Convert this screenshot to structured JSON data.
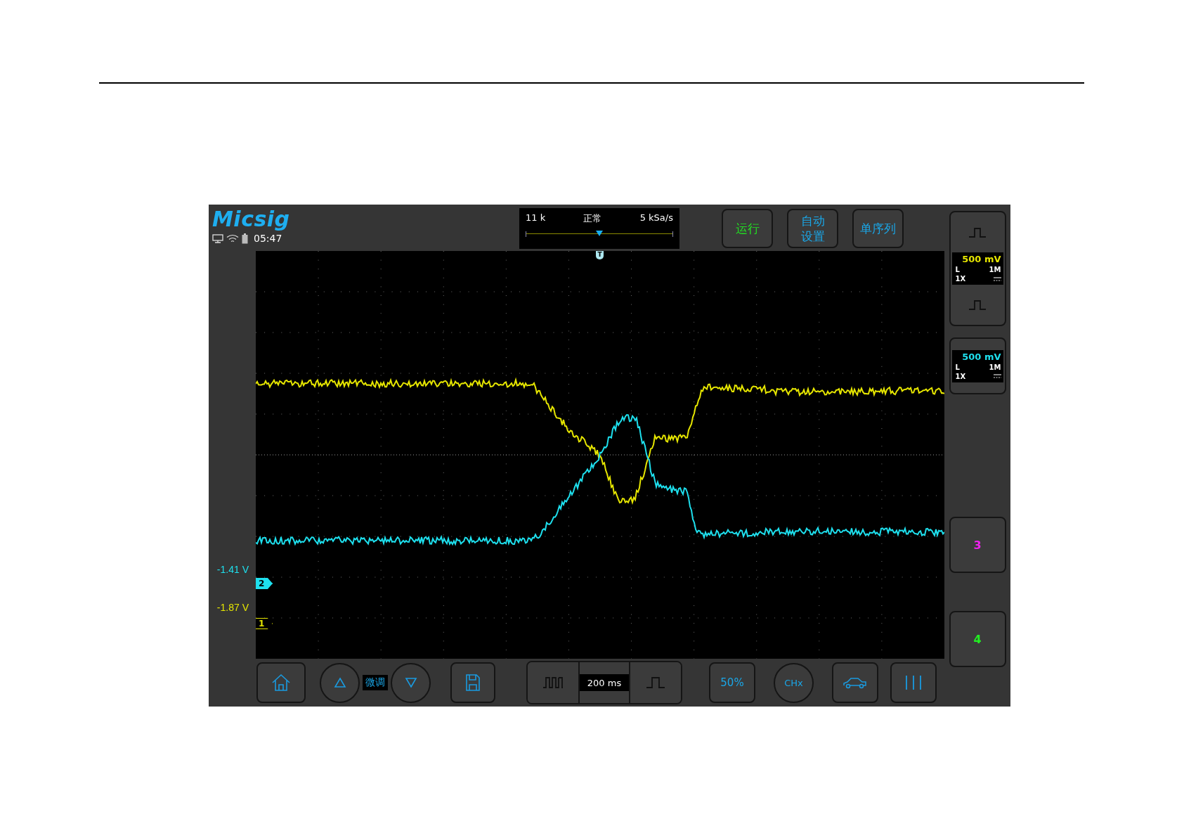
{
  "header": {
    "logo": "Micsig",
    "time": "05:47"
  },
  "acquisition": {
    "memory": "11 k",
    "mode": "正常",
    "sample_rate": "5 kSa/s",
    "level": 0.5
  },
  "top_buttons": [
    {
      "label": "运行",
      "color": "#22dd22"
    },
    {
      "label": "自动设置",
      "color": "#1aa7e8"
    },
    {
      "label": "单序列",
      "color": "#1aa7e8"
    }
  ],
  "trigger_marker": "T",
  "offset_markers": [
    {
      "marker": "2",
      "offset": "-1.41 V",
      "color": "#1ee0ee",
      "selected": true
    },
    {
      "marker": "1",
      "offset": "-1.87 V",
      "color": "#e6e600",
      "selected": false
    }
  ],
  "channels": [
    {
      "color": "#e6e600",
      "scale": "500 mV",
      "bandwidth": "L",
      "impedance": "1M",
      "probe": "1X"
    },
    {
      "color": "#1ee0ee",
      "scale": "500 mV",
      "bandwidth": "L",
      "impedance": "1M",
      "probe": "1X"
    }
  ],
  "extra_channels": [
    {
      "label": "3",
      "color": "#ee22ee"
    },
    {
      "label": "4",
      "color": "#22ee22"
    }
  ],
  "bottom_bar": {
    "fine_label": "微调",
    "timebase": "200 ms",
    "fifty_label": "50%",
    "channel_label": "CHx"
  }
}
